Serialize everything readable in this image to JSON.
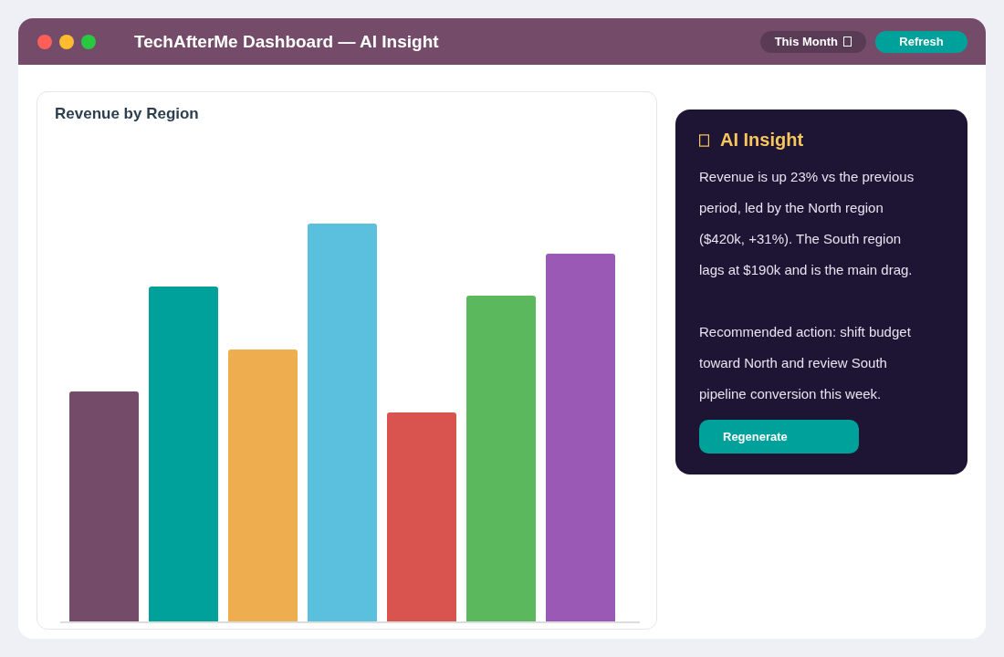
{
  "window": {
    "title": "TechAfterMe Dashboard — AI Insight"
  },
  "header_buttons": [
    {
      "kind": "dropdown",
      "label": "This Month"
    },
    {
      "kind": "primary",
      "label": "Refresh"
    }
  ],
  "chart_card": {
    "title": "Revenue by Region"
  },
  "insight": {
    "title": "AI Insight",
    "paragraphs": [
      "Revenue is up 23% vs the previous period, led by the North region ($420k, +31%). The South region lags at $190k and is the main drag.",
      "Recommended action: shift budget toward North and review South pipeline conversion this week."
    ],
    "button": "Regenerate"
  }
}
